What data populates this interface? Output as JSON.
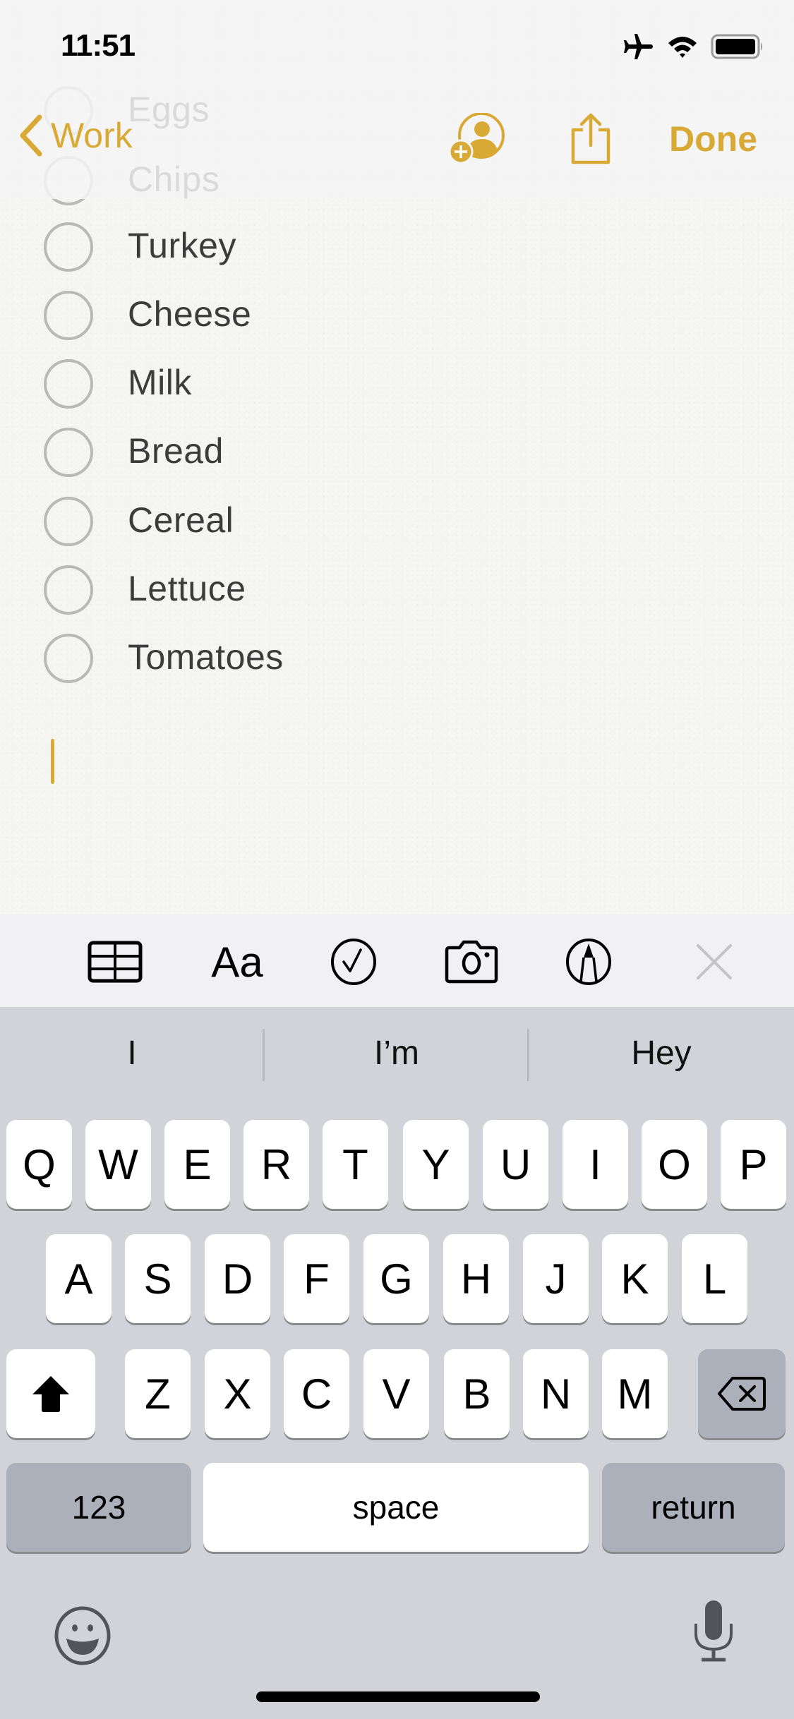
{
  "status_bar": {
    "time": "11:51",
    "icons": [
      "airplane-mode-icon",
      "wifi-icon",
      "battery-icon"
    ],
    "battery_level": 0.9
  },
  "nav": {
    "back_label": "Work",
    "done_label": "Done",
    "accent_color": "#D8AA35",
    "icons": [
      "chevron-left-icon",
      "add-person-icon",
      "share-icon"
    ]
  },
  "note": {
    "checklist": [
      {
        "label": "Eggs",
        "checked": false
      },
      {
        "label": "Chips",
        "checked": false
      },
      {
        "label": "Turkey",
        "checked": false
      },
      {
        "label": "Cheese",
        "checked": false
      },
      {
        "label": "Milk",
        "checked": false
      },
      {
        "label": "Bread",
        "checked": false
      },
      {
        "label": "Cereal",
        "checked": false
      },
      {
        "label": "Lettuce",
        "checked": false
      },
      {
        "label": "Tomatoes",
        "checked": false
      }
    ]
  },
  "toolbar": {
    "items": [
      "table-icon",
      "text-format-icon",
      "checklist-icon",
      "camera-icon",
      "markup-icon",
      "close-icon"
    ],
    "format_label": "Aa"
  },
  "keyboard": {
    "suggestions": [
      "I",
      "I’m",
      "Hey"
    ],
    "rows": [
      [
        "Q",
        "W",
        "E",
        "R",
        "T",
        "Y",
        "U",
        "I",
        "O",
        "P"
      ],
      [
        "A",
        "S",
        "D",
        "F",
        "G",
        "H",
        "J",
        "K",
        "L"
      ],
      [
        "Z",
        "X",
        "C",
        "V",
        "B",
        "N",
        "M"
      ]
    ],
    "shift_active": true,
    "numbers_label": "123",
    "space_label": "space",
    "return_label": "return",
    "bottom_icons": [
      "emoji-icon",
      "microphone-icon"
    ]
  }
}
